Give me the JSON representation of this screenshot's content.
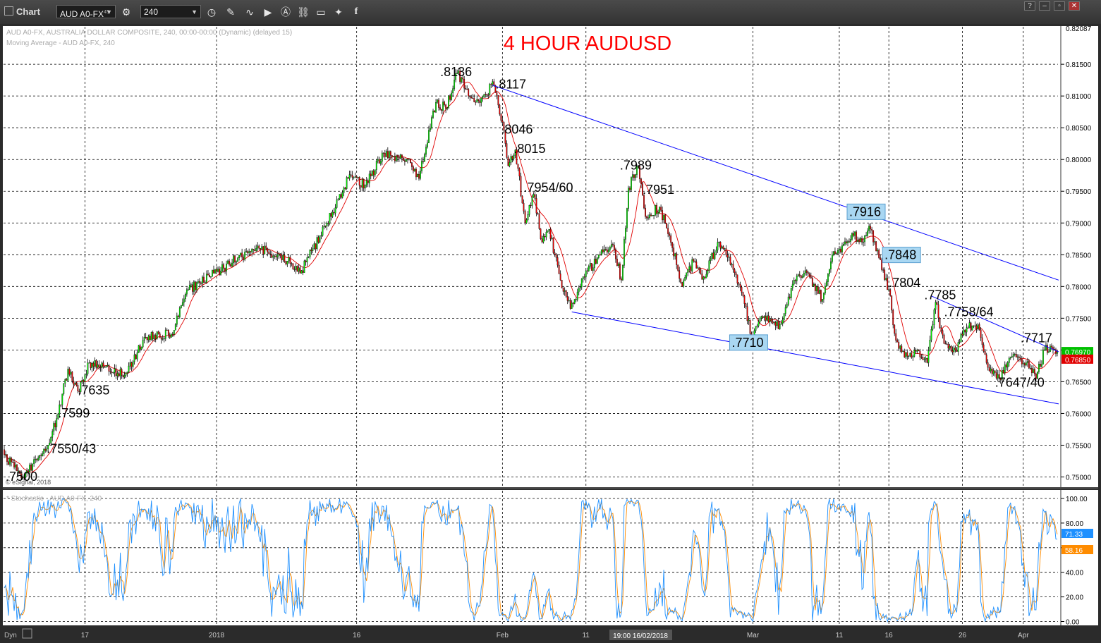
{
  "window": {
    "title": "Chart",
    "symbol": "AUD A0-FX",
    "symbol_sup": "45",
    "interval": "240",
    "buttons": {
      "help": "?",
      "minimize": "–",
      "restore": "▫",
      "close": "✕"
    }
  },
  "header": {
    "line1": "AUD A0-FX, AUSTRALIA DOLLAR COMPOSITE, 240, 00:00-00:00 (Dynamic) (delayed 15)",
    "line2": "Moving Average - AUD A0-FX, 240"
  },
  "copyright": "© eSignal, 2018",
  "footer": {
    "dyn": "Dyn",
    "crosshair_time": "19:00 16/02/2018"
  },
  "colors": {
    "background": "#ffffff",
    "chrome": "#2b2b2b",
    "up_candle": "#00e600",
    "down_candle": "#e00000",
    "moving_average": "#e00000",
    "trendline": "#0000ff",
    "title": "#ff0000",
    "stoch_k": "#1e90ff",
    "stoch_d": "#ff8c00",
    "label_box": "#a9d7f2"
  },
  "chart_data": [
    {
      "type": "candlestick",
      "title": "4 HOUR AUDUSD",
      "ylim": [
        0.7485,
        0.8209
      ],
      "y_ticks": [
        "0.81500",
        "0.81000",
        "0.80500",
        "0.80000",
        "0.79500",
        "0.79000",
        "0.78500",
        "0.78000",
        "0.77500",
        "0.77000",
        "0.76500",
        "0.76000",
        "0.75500",
        "0.75000"
      ],
      "y_tick_values": [
        0.815,
        0.81,
        0.805,
        0.8,
        0.795,
        0.79,
        0.785,
        0.78,
        0.775,
        0.77,
        0.765,
        0.76,
        0.755,
        0.75
      ],
      "y_top_label": "0.82087",
      "x_ticks": [
        "17",
        "2018",
        "16",
        "Feb",
        "11",
        "Mar",
        "11",
        "16",
        "26",
        "Apr"
      ],
      "x_tick_index": [
        57,
        150,
        249,
        352,
        411,
        529,
        590,
        625,
        677,
        720
      ],
      "bar_count": 745,
      "key_points": [
        {
          "i": 0,
          "price": 0.7535
        },
        {
          "i": 13,
          "price": 0.75
        },
        {
          "i": 24,
          "price": 0.753
        },
        {
          "i": 31,
          "price": 0.755
        },
        {
          "i": 38,
          "price": 0.7599
        },
        {
          "i": 45,
          "price": 0.767
        },
        {
          "i": 52,
          "price": 0.7635
        },
        {
          "i": 60,
          "price": 0.768
        },
        {
          "i": 85,
          "price": 0.766
        },
        {
          "i": 100,
          "price": 0.772
        },
        {
          "i": 118,
          "price": 0.7725
        },
        {
          "i": 130,
          "price": 0.7795
        },
        {
          "i": 145,
          "price": 0.7815
        },
        {
          "i": 165,
          "price": 0.7845
        },
        {
          "i": 180,
          "price": 0.786
        },
        {
          "i": 200,
          "price": 0.784
        },
        {
          "i": 210,
          "price": 0.7825
        },
        {
          "i": 228,
          "price": 0.79
        },
        {
          "i": 243,
          "price": 0.797
        },
        {
          "i": 255,
          "price": 0.796
        },
        {
          "i": 268,
          "price": 0.801
        },
        {
          "i": 285,
          "price": 0.8
        },
        {
          "i": 293,
          "price": 0.797
        },
        {
          "i": 305,
          "price": 0.809
        },
        {
          "i": 312,
          "price": 0.808
        },
        {
          "i": 320,
          "price": 0.8136
        },
        {
          "i": 333,
          "price": 0.809
        },
        {
          "i": 346,
          "price": 0.8117
        },
        {
          "i": 353,
          "price": 0.8046
        },
        {
          "i": 356,
          "price": 0.799
        },
        {
          "i": 361,
          "price": 0.8015
        },
        {
          "i": 368,
          "price": 0.79
        },
        {
          "i": 374,
          "price": 0.7945
        },
        {
          "i": 380,
          "price": 0.787
        },
        {
          "i": 385,
          "price": 0.789
        },
        {
          "i": 393,
          "price": 0.781
        },
        {
          "i": 400,
          "price": 0.7765
        },
        {
          "i": 410,
          "price": 0.7815
        },
        {
          "i": 420,
          "price": 0.785
        },
        {
          "i": 430,
          "price": 0.7865
        },
        {
          "i": 436,
          "price": 0.781
        },
        {
          "i": 441,
          "price": 0.7955
        },
        {
          "i": 448,
          "price": 0.7989
        },
        {
          "i": 453,
          "price": 0.791
        },
        {
          "i": 463,
          "price": 0.7925
        },
        {
          "i": 470,
          "price": 0.788
        },
        {
          "i": 479,
          "price": 0.78
        },
        {
          "i": 487,
          "price": 0.784
        },
        {
          "i": 494,
          "price": 0.7815
        },
        {
          "i": 505,
          "price": 0.787
        },
        {
          "i": 514,
          "price": 0.7835
        },
        {
          "i": 522,
          "price": 0.7785
        },
        {
          "i": 528,
          "price": 0.772
        },
        {
          "i": 534,
          "price": 0.775
        },
        {
          "i": 542,
          "price": 0.7745
        },
        {
          "i": 548,
          "price": 0.774
        },
        {
          "i": 558,
          "price": 0.781
        },
        {
          "i": 568,
          "price": 0.782
        },
        {
          "i": 578,
          "price": 0.778
        },
        {
          "i": 585,
          "price": 0.785
        },
        {
          "i": 600,
          "price": 0.788
        },
        {
          "i": 606,
          "price": 0.787
        },
        {
          "i": 611,
          "price": 0.7895
        },
        {
          "i": 618,
          "price": 0.7845
        },
        {
          "i": 625,
          "price": 0.7795
        },
        {
          "i": 630,
          "price": 0.7715
        },
        {
          "i": 638,
          "price": 0.769
        },
        {
          "i": 645,
          "price": 0.77
        },
        {
          "i": 652,
          "price": 0.768
        },
        {
          "i": 658,
          "price": 0.7775
        },
        {
          "i": 664,
          "price": 0.771
        },
        {
          "i": 672,
          "price": 0.77
        },
        {
          "i": 680,
          "price": 0.7735
        },
        {
          "i": 688,
          "price": 0.774
        },
        {
          "i": 694,
          "price": 0.768
        },
        {
          "i": 703,
          "price": 0.7655
        },
        {
          "i": 712,
          "price": 0.769
        },
        {
          "i": 722,
          "price": 0.768
        },
        {
          "i": 729,
          "price": 0.7655
        },
        {
          "i": 735,
          "price": 0.77
        },
        {
          "i": 744,
          "price": 0.7697
        }
      ],
      "moving_average_period": 12,
      "annotations": [
        {
          "text": ".7500",
          "i": 1,
          "price": 0.7494
        },
        {
          "text": ".7550/43",
          "i": 30,
          "price": 0.7538
        },
        {
          "text": ".7599",
          "i": 38,
          "price": 0.7594
        },
        {
          "text": ".7635",
          "i": 52,
          "price": 0.763
        },
        {
          "text": ".8136",
          "i": 308,
          "price": 0.8131
        },
        {
          "text": ".8117",
          "i": 347,
          "price": 0.8112
        },
        {
          "text": ".8046",
          "i": 351,
          "price": 0.8041
        },
        {
          "text": ".8015",
          "i": 360,
          "price": 0.801
        },
        {
          "text": ".7954/60",
          "i": 367,
          "price": 0.7949
        },
        {
          "text": ".7989",
          "i": 435,
          "price": 0.7984
        },
        {
          "text": ".7951",
          "i": 451,
          "price": 0.7946
        },
        {
          "text": ".7916",
          "i": 597,
          "price": 0.7911,
          "boxed": true
        },
        {
          "text": ".7848",
          "i": 622,
          "price": 0.7843,
          "boxed": true
        },
        {
          "text": ".7804",
          "i": 625,
          "price": 0.7799
        },
        {
          "text": ".7785",
          "i": 650,
          "price": 0.778
        },
        {
          "text": ".7758/64",
          "i": 664,
          "price": 0.7753
        },
        {
          "text": ".7710",
          "i": 514,
          "price": 0.7705,
          "boxed": true
        },
        {
          "text": ".7717",
          "i": 718,
          "price": 0.7712
        },
        {
          "text": ".7647/40",
          "i": 700,
          "price": 0.7642
        }
      ],
      "trendlines": [
        {
          "from": {
            "i": 345,
            "price": 0.8117
          },
          "to": {
            "i": 745,
            "price": 0.781
          }
        },
        {
          "from": {
            "i": 401,
            "price": 0.776
          },
          "to": {
            "i": 745,
            "price": 0.7615
          }
        },
        {
          "from": {
            "i": 655,
            "price": 0.7785
          },
          "to": {
            "i": 745,
            "price": 0.7697
          }
        }
      ],
      "price_labels": [
        {
          "text": "0.76970",
          "price": 0.7697,
          "color": "#00c000"
        },
        {
          "text": "0.76850",
          "price": 0.7685,
          "color": "#e00000"
        }
      ]
    },
    {
      "type": "line",
      "title": "* Stochastic - AUD A0-FX, 240",
      "ylim": [
        -2,
        104
      ],
      "y_ticks": [
        "100.00",
        "80.00",
        "60.00",
        "40.00",
        "20.00",
        "0.00"
      ],
      "y_tick_values": [
        100,
        80,
        60,
        40,
        20,
        0
      ],
      "current_values": [
        {
          "name": "%K",
          "text": "71.33",
          "value": 71.33,
          "color": "#1e90ff"
        },
        {
          "name": "%D",
          "text": "58.16",
          "value": 58.16,
          "color": "#ff8c00"
        }
      ],
      "k_period": 14,
      "d_period": 3
    }
  ]
}
